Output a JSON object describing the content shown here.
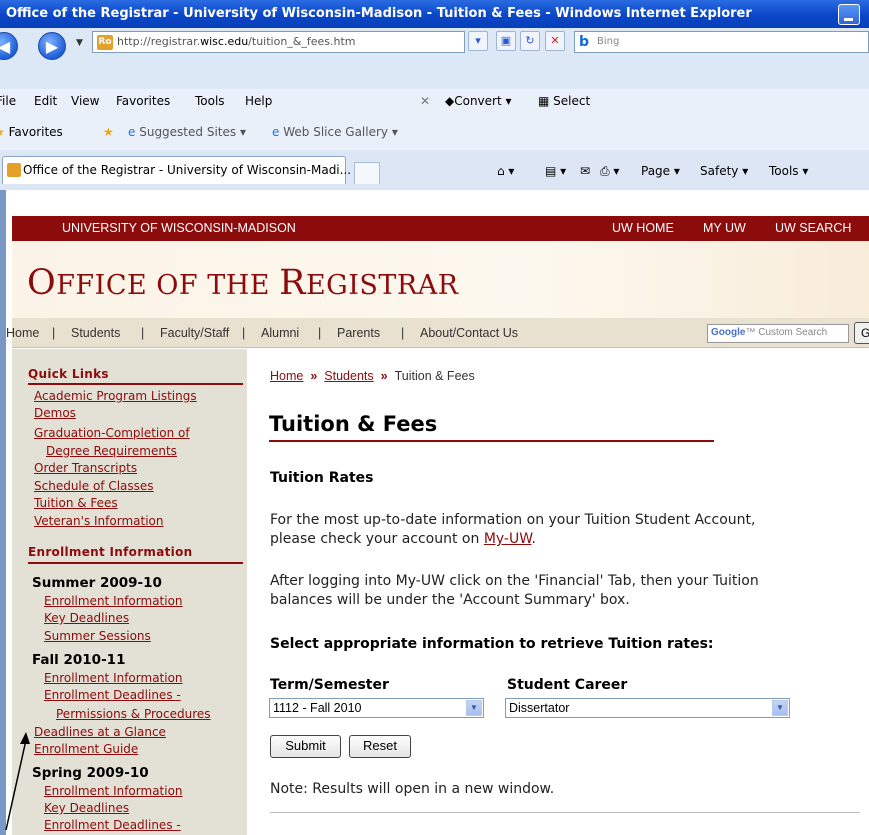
{
  "browser": {
    "window_title": "Office of the Registrar - University of Wisconsin-Madison - Tuition & Fees - Windows Internet Explorer",
    "url_prefix": "http://registrar.",
    "url_domain": "wisc.edu",
    "url_path": "/tuition_&_fees.htm",
    "search_engine": "Bing",
    "menu": [
      "File",
      "Edit",
      "View",
      "Favorites",
      "Tools",
      "Help"
    ],
    "convert_label": "Convert",
    "select_label": "Select",
    "favorites_label": "Favorites",
    "suggested_sites": "Suggested Sites",
    "web_slice": "Web Slice Gallery",
    "tab_title": "Office of the Registrar - University of Wisconsin-Madi...",
    "cmd_page": "Page",
    "cmd_safety": "Safety",
    "cmd_tools": "Tools",
    "accent": "#0a46c8"
  },
  "site": {
    "university": "UNIVERSITY OF WISCONSIN-MADISON",
    "top_links": [
      "UW HOME",
      "MY UW",
      "UW SEARCH"
    ],
    "title_first": "O",
    "title_rest1": "FFICE OF THE ",
    "title_r": "R",
    "title_rest2": "EGISTRAR",
    "nav": [
      "Home",
      "Students",
      "Faculty/Staff",
      "Alumni",
      "Parents",
      "About/Contact Us"
    ],
    "nav_sep": "|",
    "google_label": "Google",
    "google_search_placeholder": "Custom Search",
    "go_label": "Go",
    "brand_color": "#8c0b0b"
  },
  "sidebar": {
    "quick_links_header": "Quick Links",
    "quick_links": [
      "Academic Program Listings",
      "Demos",
      "Graduation-Completion of",
      "Degree Requirements",
      "Order Transcripts",
      "Schedule of Classes",
      "Tuition & Fees",
      "Veteran's Information"
    ],
    "enrollment_header": "Enrollment Information",
    "summer": {
      "title": "Summer 2009-10",
      "links": [
        "Enrollment Information",
        "Key Deadlines",
        "Summer Sessions"
      ]
    },
    "fall": {
      "title": "Fall 2010-11",
      "links": [
        "Enrollment Information",
        "Enrollment Deadlines -",
        "Permissions & Procedures",
        "Deadlines at a Glance",
        "Enrollment Guide"
      ]
    },
    "spring": {
      "title": "Spring 2009-10",
      "links": [
        "Enrollment Information",
        "Key Deadlines",
        "Enrollment Deadlines -"
      ]
    }
  },
  "main": {
    "breadcrumb": [
      "Home",
      "Students",
      "Tuition & Fees"
    ],
    "breadcrumb_sep": "»",
    "heading": "Tuition & Fees",
    "subheading": "Tuition Rates",
    "para1_line1": "For the most up-to-date information on your Tuition Student Account,",
    "para1_line2_pre": "please check your account on ",
    "para1_link": "My-UW",
    "para1_line2_post": ".",
    "para2_line1": "After logging into My-UW click on the 'Financial' Tab, then your Tuition",
    "para2_line2": "balances will be under the 'Account Summary' box.",
    "select_prompt": "Select appropriate information to retrieve Tuition rates:",
    "term_label": "Term/Semester",
    "term_value": "1112 - Fall 2010",
    "career_label": "Student Career",
    "career_value": "Dissertator",
    "submit_label": "Submit",
    "reset_label": "Reset",
    "note": "Note: Results will open in a new window."
  }
}
